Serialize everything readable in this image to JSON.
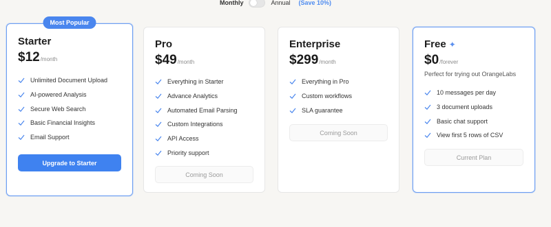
{
  "billing": {
    "monthly_label": "Monthly",
    "annual_label": "Annual",
    "save_label": "(Save 10%)",
    "annual_selected": false
  },
  "plans": [
    {
      "badge": "Most Popular",
      "name": "Starter",
      "price": "$12",
      "period": "/month",
      "features": [
        "Unlimited Document Upload",
        "AI-powered Analysis",
        "Secure Web Search",
        "Basic Financial Insights",
        "Email Support"
      ],
      "button": "Upgrade to Starter"
    },
    {
      "name": "Pro",
      "price": "$49",
      "period": "/month",
      "features": [
        "Everything in Starter",
        "Advance Analytics",
        "Automated Email Parsing",
        "Custom Integrations",
        "API Access",
        "Priority support"
      ],
      "button": "Coming Soon"
    },
    {
      "name": "Enterprise",
      "price": "$299",
      "period": "/month",
      "features": [
        "Everything in Pro",
        "Custom workflows",
        "SLA guarantee"
      ],
      "button": "Coming Soon"
    },
    {
      "name": "Free",
      "price": "$0",
      "period": "/forever",
      "description": "Perfect for trying out OrangeLabs",
      "features": [
        "10 messages per day",
        "3 document uploads",
        "Basic chat support",
        "View first 5 rows of CSV"
      ],
      "button": "Current Plan"
    }
  ],
  "colors": {
    "accent": "#3f82f0",
    "check": "#4a86ee",
    "background": "#f7f6f3"
  }
}
